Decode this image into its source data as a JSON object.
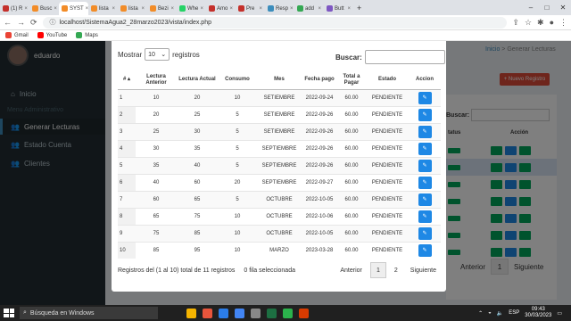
{
  "browser": {
    "tabs": [
      {
        "label": "(1) R",
        "color": "#c4302b"
      },
      {
        "label": "Busc",
        "color": "#f28c28"
      },
      {
        "label": "SYST",
        "color": "#f28c28",
        "active": true
      },
      {
        "label": "lista",
        "color": "#f28c28"
      },
      {
        "label": "lista",
        "color": "#f28c28"
      },
      {
        "label": "Bezi",
        "color": "#f28c28"
      },
      {
        "label": "Whe",
        "color": "#25d366"
      },
      {
        "label": "Amo",
        "color": "#c4302b"
      },
      {
        "label": "Pre",
        "color": "#c4302b"
      },
      {
        "label": "Resp",
        "color": "#3c8dbc"
      },
      {
        "label": "add",
        "color": "#34a853"
      },
      {
        "label": "Butt",
        "color": "#7e57c2"
      }
    ],
    "url": "localhost/SistemaAgua2_28marzo2023/vista/index.php",
    "bookmarks": [
      "Gmail",
      "YouTube",
      "Maps"
    ]
  },
  "sidebar": {
    "user": "eduardo",
    "items": [
      {
        "label": "Inicio",
        "icon": "home-icon"
      },
      {
        "label": "Generar Lecturas",
        "icon": "users-icon"
      },
      {
        "label": "Estado Cuenta",
        "icon": "users-icon"
      },
      {
        "label": "Clientes",
        "icon": "users-icon"
      }
    ],
    "section": "Menu Administrativo"
  },
  "background": {
    "breadcrumb_home": "Inicio",
    "breadcrumb_current": "Generar Lecturas",
    "new_button": "+ Nuevo Registro",
    "search_label": "Buscar:",
    "col_estado": "tatus",
    "col_accion": "Acción",
    "prev": "Anterior",
    "page": "1",
    "next": "Siguiente"
  },
  "modal": {
    "show_label": "Mostrar",
    "show_value": "10",
    "records_label": "registros",
    "search_label": "Buscar:",
    "headers": [
      "#",
      "Lectura Anterior",
      "Lectura Actual",
      "Consumo",
      "Mes",
      "Fecha pago",
      "Total a Pagar",
      "Estado",
      "Accion"
    ],
    "rows": [
      [
        "1",
        "10",
        "20",
        "10",
        "SETIEMBRE",
        "2022-09-24",
        "60.00",
        "PENDIENTE"
      ],
      [
        "2",
        "20",
        "25",
        "5",
        "SETIEMBRE",
        "2022-09-26",
        "60.00",
        "PENDIENTE"
      ],
      [
        "3",
        "25",
        "30",
        "5",
        "SETIEMBRE",
        "2022-09-26",
        "60.00",
        "PENDIENTE"
      ],
      [
        "4",
        "30",
        "35",
        "5",
        "SEPTIEMBRE",
        "2022-09-26",
        "60.00",
        "PENDIENTE"
      ],
      [
        "5",
        "35",
        "40",
        "5",
        "SEPTIEMBRE",
        "2022-09-26",
        "60.00",
        "PENDIENTE"
      ],
      [
        "6",
        "40",
        "60",
        "20",
        "SEPTIEMBRE",
        "2022-09-27",
        "60.00",
        "PENDIENTE"
      ],
      [
        "7",
        "60",
        "65",
        "5",
        "OCTUBRE",
        "2022-10-05",
        "60.00",
        "PENDIENTE"
      ],
      [
        "8",
        "65",
        "75",
        "10",
        "OCTUBRE",
        "2022-10-06",
        "60.00",
        "PENDIENTE"
      ],
      [
        "9",
        "75",
        "85",
        "10",
        "OCTUBRE",
        "2022-10-05",
        "60.00",
        "PENDIENTE"
      ],
      [
        "10",
        "85",
        "95",
        "10",
        "MARZO",
        "2023-03-28",
        "60.00",
        "PENDIENTE"
      ]
    ],
    "info": "Registros del (1 al 10) total de 11 registros",
    "selected": "0 fila seleccionada",
    "prev": "Anterior",
    "pages": [
      "1",
      "2"
    ],
    "next": "Siguiente"
  },
  "taskbar": {
    "search": "Búsqueda en Windows",
    "lang": "ESP",
    "time": "09:43",
    "date": "30/03/2023"
  }
}
